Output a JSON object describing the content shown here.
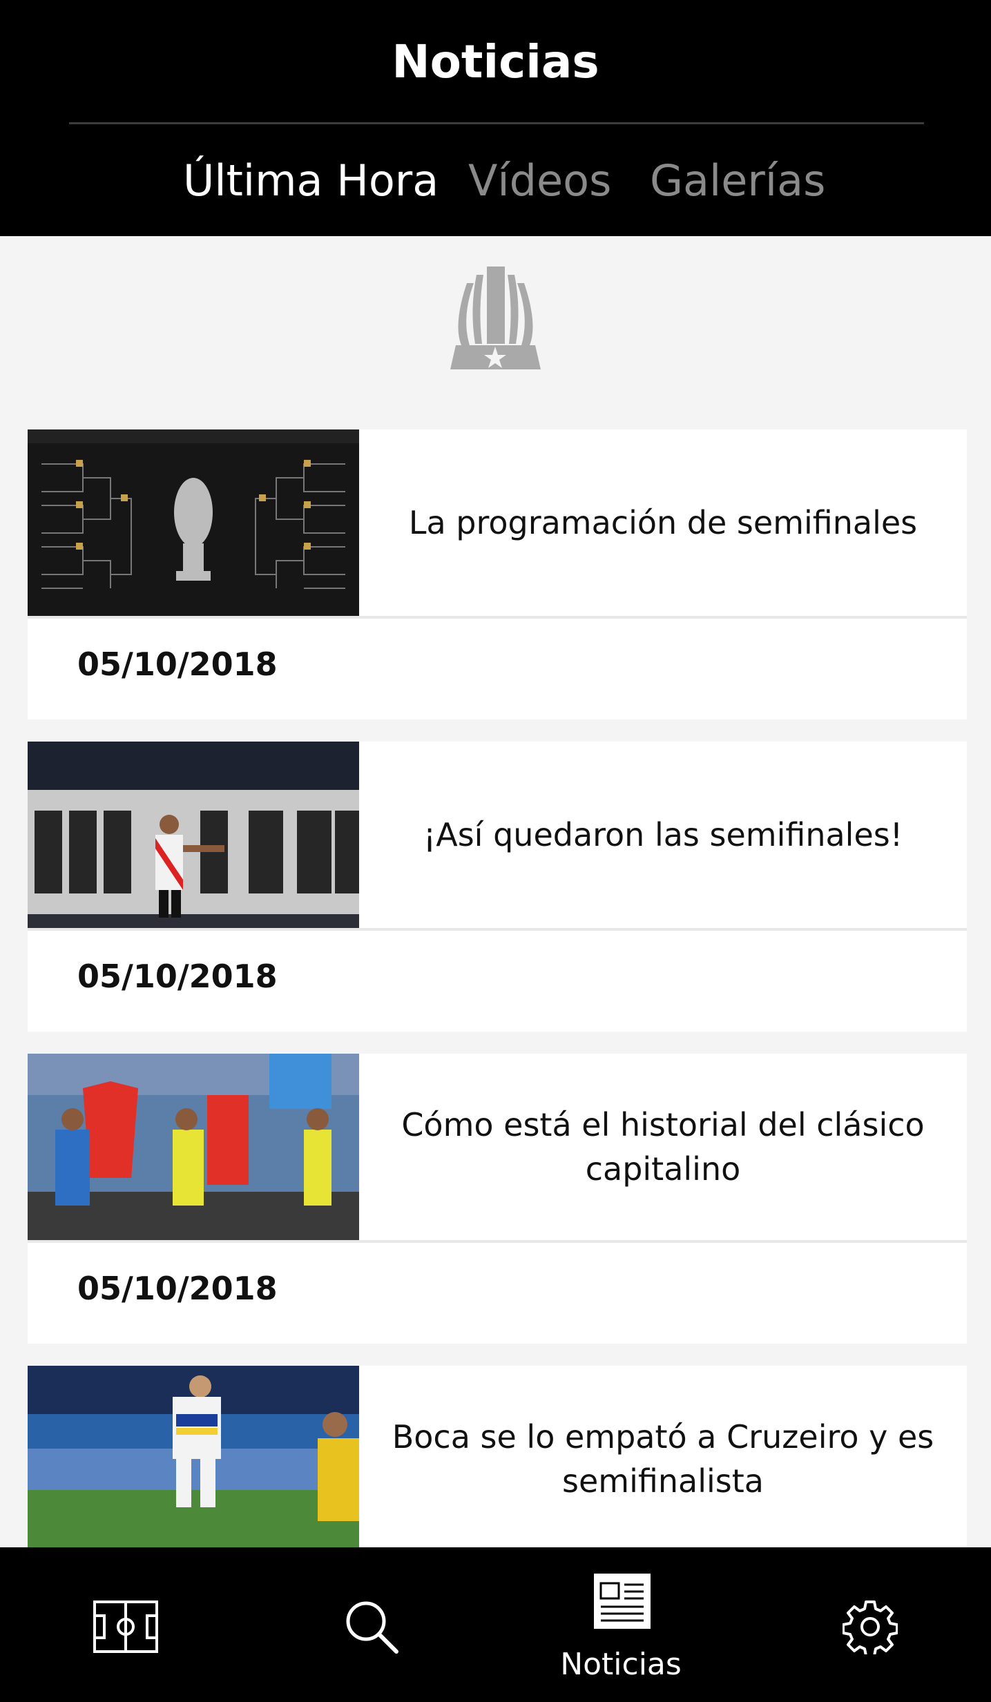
{
  "header": {
    "title": "Noticias",
    "tabs": [
      {
        "label": "Última Hora",
        "active": true
      },
      {
        "label": "Vídeos",
        "active": false
      },
      {
        "label": "Galerías",
        "active": false
      }
    ]
  },
  "logo": {
    "icon": "trophy-logo-icon"
  },
  "news": [
    {
      "headline": "La programación de semifinales",
      "date": "05/10/2018",
      "thumb_icon": "bracket-thumbnail"
    },
    {
      "headline": "¡Así quedaron las semifinales!",
      "date": "05/10/2018",
      "thumb_icon": "player-celebration-thumbnail"
    },
    {
      "headline": "Cómo está el historial del clásico capitalino",
      "date": "05/10/2018",
      "thumb_icon": "jerseys-thumbnail"
    },
    {
      "headline": "Boca se lo empató a Cruzeiro y es semifinalista",
      "date": "",
      "thumb_icon": "match-thumbnail"
    }
  ],
  "tabbar": {
    "items": [
      {
        "icon": "field-icon",
        "label": ""
      },
      {
        "icon": "search-icon",
        "label": ""
      },
      {
        "icon": "newspaper-icon",
        "label": "Noticias",
        "active": true
      },
      {
        "icon": "gear-icon",
        "label": ""
      }
    ]
  },
  "colors": {
    "background": "#f4f4f4",
    "header": "#000000",
    "active_tab": "#ffffff",
    "inactive_tab": "#8a8a8a"
  }
}
